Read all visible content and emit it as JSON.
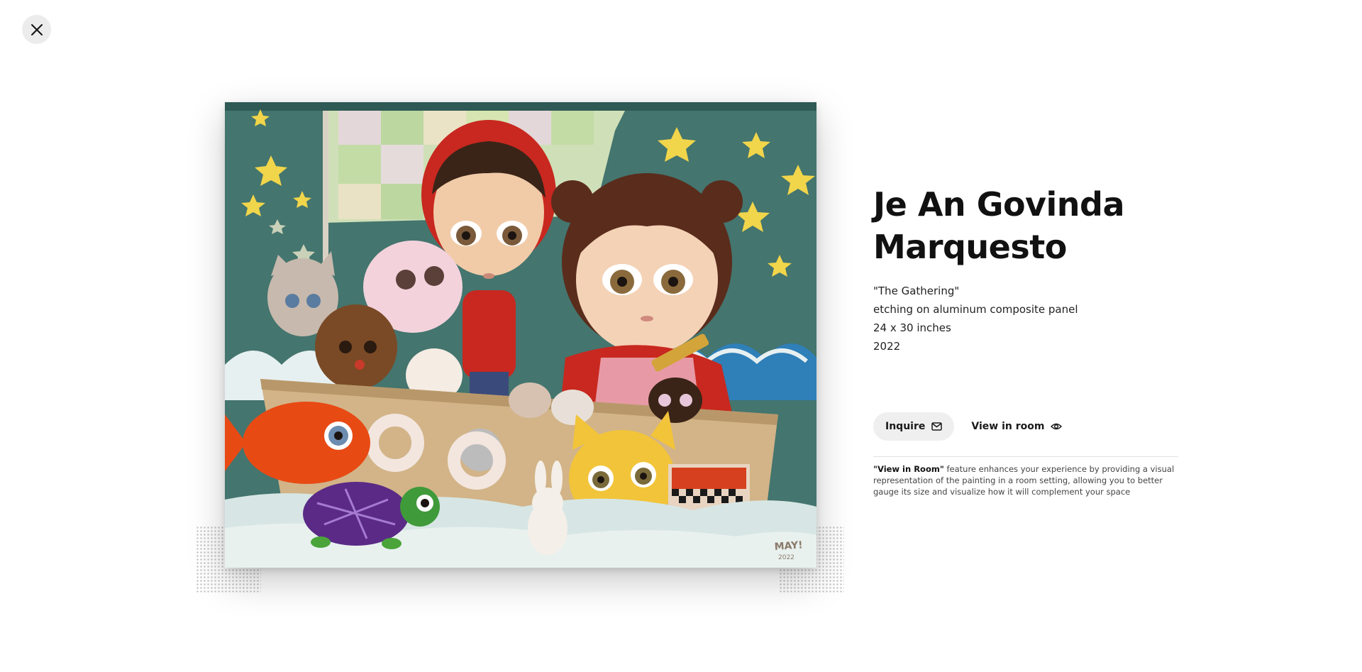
{
  "close": {
    "icon": "close-icon"
  },
  "artwork": {
    "artist": "Je An Govinda Marquesto",
    "title": "\"The Gathering\"",
    "medium": "etching on aluminum composite panel",
    "dimensions": "24 x 30 inches",
    "year": "2022",
    "signature": "MAY! 2022"
  },
  "actions": {
    "inquire_label": "Inquire",
    "inquire_icon": "mail-icon",
    "view_label": "View in room",
    "view_icon": "eye-icon"
  },
  "note": {
    "bold": "\"View in Room\"",
    "text": " feature enhances your experience by providing a visual representation of the painting in a room setting, allowing you to better gauge its size and visualize how it will complement your space"
  },
  "colors": {
    "background": "#ffffff",
    "button_bg": "#efefef",
    "close_bg": "#ececec",
    "text": "#111111"
  }
}
